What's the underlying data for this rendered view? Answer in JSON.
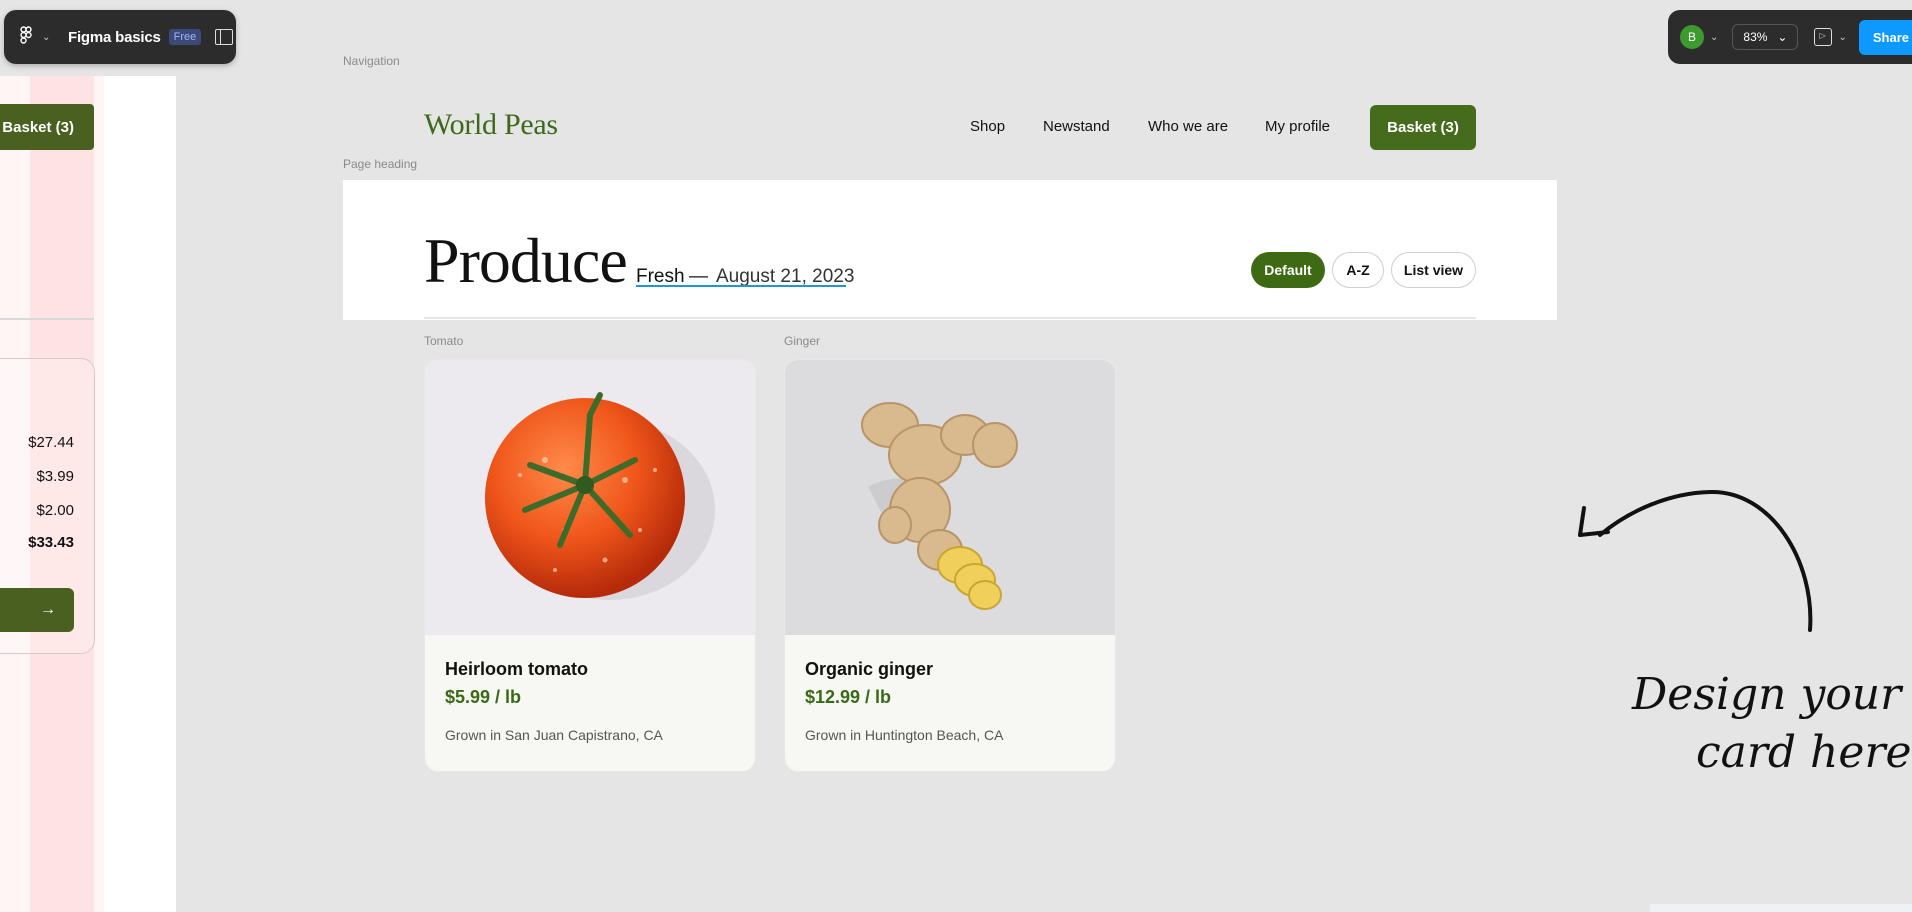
{
  "figma": {
    "file_name": "Figma basics",
    "plan_badge": "Free",
    "avatar_initial": "B",
    "zoom": "83%",
    "share_label": "Share"
  },
  "layers": {
    "navigation": "Navigation",
    "page_heading": "Page heading",
    "tomato": "Tomato",
    "ginger": "Ginger"
  },
  "left_frame": {
    "basket_label": "Basket (3)",
    "prices": [
      "$27.44",
      "$3.99",
      "$2.00",
      "$33.43"
    ]
  },
  "nav": {
    "logo": "World Peas",
    "links": [
      "Shop",
      "Newstand",
      "Who we are",
      "My profile"
    ],
    "basket_label": "Basket (3)"
  },
  "heading": {
    "title": "Produce",
    "subtitle_fresh": "Fresh",
    "subtitle_dash": "—",
    "subtitle_date": "August 21, 2023",
    "sort_options": [
      "Default",
      "A-Z",
      "List view"
    ],
    "active_sort": "Default"
  },
  "products": [
    {
      "name": "Heirloom tomato",
      "price": "$5.99 / lb",
      "origin": "Grown in San Juan Capistrano, CA"
    },
    {
      "name": "Organic ginger",
      "price": "$12.99 / lb",
      "origin": "Grown in Huntington Beach, CA"
    }
  ],
  "annotation": {
    "line1": "Design your o",
    "line2": "card here."
  },
  "colors": {
    "brand_green": "#456b1c",
    "canvas": "#e5e5e5",
    "share_blue": "#0d99ff"
  }
}
